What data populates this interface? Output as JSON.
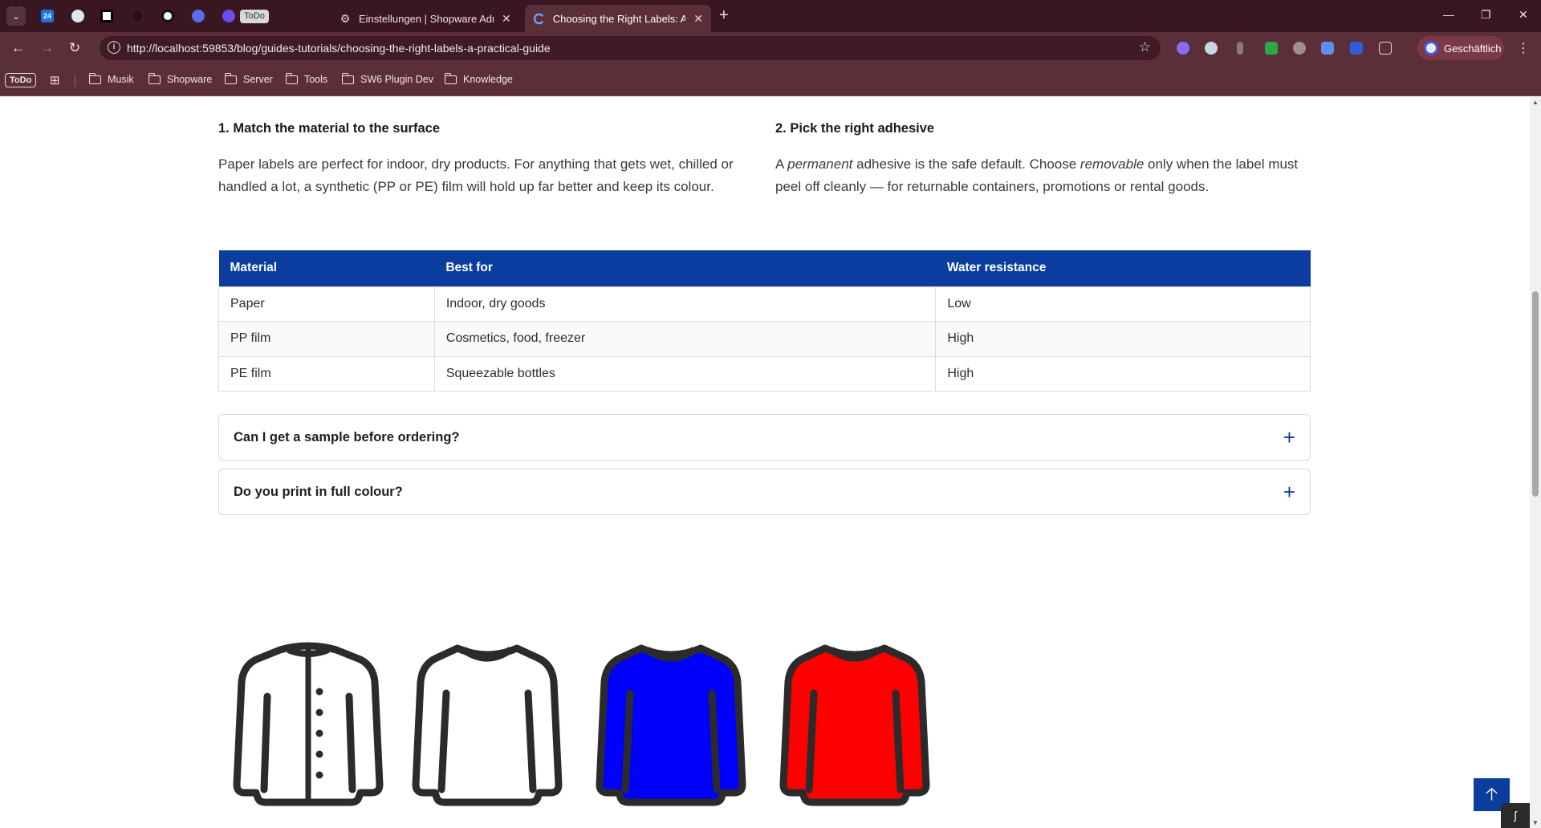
{
  "browser": {
    "pinned_todo": "ToDo",
    "pinned_24": "24",
    "tabs": [
      {
        "title": "Einstellungen | Shopware Admin",
        "close": "✕"
      },
      {
        "title": "Choosing the Right Labels: A Pr",
        "close": "✕"
      }
    ],
    "new_tab": "+",
    "window_controls": {
      "minimize": "—",
      "restore": "❐",
      "close": "✕"
    },
    "url": "http://localhost:59853/blog/guides-tutorials/choosing-the-right-labels-a-practical-guide",
    "profile_label": "Geschäftlich",
    "bookmarks": {
      "todo": "ToDo",
      "folders": [
        "Musik",
        "Shopware",
        "Server",
        "Tools",
        "SW6 Plugin Dev",
        "Knowledge"
      ]
    }
  },
  "article": {
    "col1": {
      "heading": "1. Match the material to the surface",
      "text": "Paper labels are perfect for indoor, dry products. For anything that gets wet, chilled or handled a lot, a synthetic (PP or PE) film will hold up far better and keep its colour."
    },
    "col2": {
      "heading": "2. Pick the right adhesive",
      "text_a": "A ",
      "em1": "permanent",
      "text_b": " adhesive is the safe default. Choose ",
      "em2": "removable",
      "text_c": " only when the label must peel off cleanly — for returnable containers, promotions or rental goods."
    },
    "table": {
      "headers": [
        "Material",
        "Best for",
        "Water resistance"
      ],
      "rows": [
        [
          "Paper",
          "Indoor, dry goods",
          "Low"
        ],
        [
          "PP film",
          "Cosmetics, food, freezer",
          "High"
        ],
        [
          "PE film",
          "Squeezable bottles",
          "High"
        ]
      ]
    },
    "faq": [
      {
        "question": "Can I get a sample before ordering?",
        "toggle": "+"
      },
      {
        "question": "Do you print in full colour?",
        "toggle": "+"
      }
    ],
    "shirt_colors": [
      "#ffffff",
      "#ffffff",
      "#0000ff",
      "#ff0000"
    ],
    "back_to_top": "🡡"
  }
}
